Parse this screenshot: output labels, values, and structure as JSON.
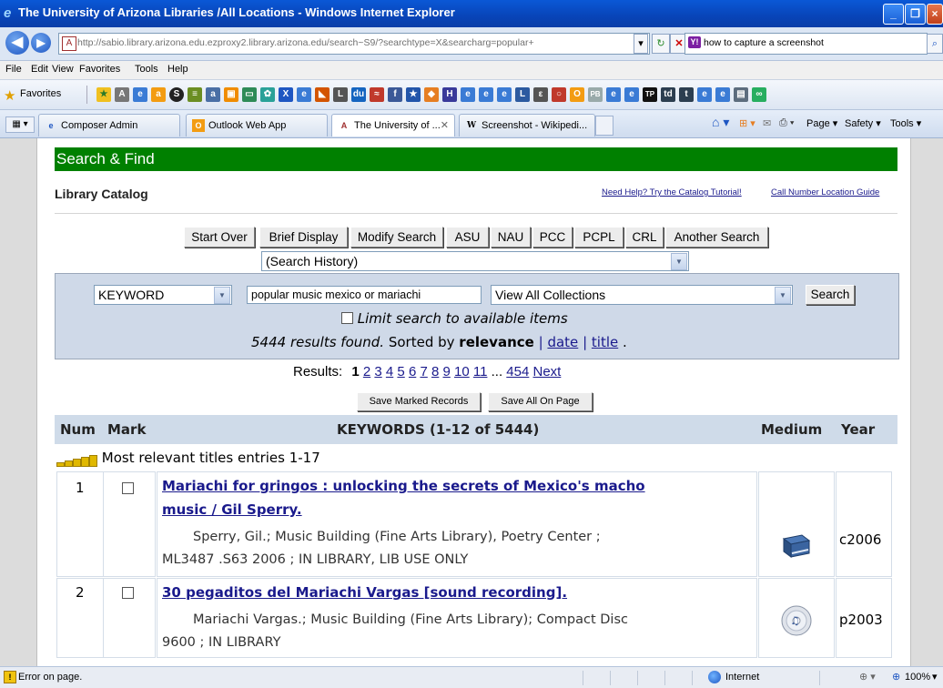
{
  "window": {
    "title": "The University of Arizona Libraries /All Locations - Windows Internet Explorer"
  },
  "address_bar": {
    "url": "http://sabio.library.arizona.edu.ezproxy2.library.arizona.edu/search~S9/?searchtype=X&searcharg=popular+",
    "search_text": "how to capture a screenshot"
  },
  "menu": [
    "File",
    "Edit",
    "View",
    "Favorites",
    "Tools",
    "Help"
  ],
  "favorites_label": "Favorites",
  "tabs": [
    {
      "label": "Composer Admin",
      "icon": "composer-icon"
    },
    {
      "label": "Outlook Web App",
      "icon": "outlook-icon"
    },
    {
      "label": "The University of ...",
      "icon": "ua-library-icon",
      "active": true
    },
    {
      "label": "Screenshot - Wikipedi...",
      "icon": "wikipedia-icon"
    }
  ],
  "commands": {
    "page": "Page",
    "safety": "Safety",
    "tools": "Tools"
  },
  "page": {
    "banner": "Search & Find",
    "section_title": "Library Catalog",
    "help_link": "Need Help? Try the Catalog Tutorial!",
    "guide_link": "Call Number Location Guide",
    "buttons": [
      "Start Over",
      "Brief Display",
      "Modify Search",
      "ASU",
      "NAU",
      "PCC",
      "PCPL",
      "CRL",
      "Another Search"
    ],
    "history_select": "(Search History)",
    "search": {
      "type": "KEYWORD",
      "query": "popular music mexico or mariachi",
      "collection": "View All Collections",
      "button": "Search",
      "limit_label": "Limit search to available items",
      "results_count": "5444 results found.",
      "sorted_by": "Sorted by",
      "sort_current": "relevance",
      "sort_date": "date",
      "sort_title": "title"
    },
    "pagination": {
      "label": "Results:",
      "current": "1",
      "pages": [
        "2",
        "3",
        "4",
        "5",
        "6",
        "7",
        "8",
        "9",
        "10",
        "11"
      ],
      "ellipsis": "...",
      "last": "454",
      "next": "Next"
    },
    "save_marked": "Save Marked Records",
    "save_all": "Save All On Page",
    "table": {
      "headers": {
        "num": "Num",
        "mark": "Mark",
        "keywords": "KEYWORDS (1-12 of 5444)",
        "medium": "Medium",
        "year": "Year"
      },
      "relevance_note": "Most relevant titles entries 1-17",
      "rows": [
        {
          "num": "1",
          "title_line1": "Mariachi for gringos : unlocking the secrets of Mexico's macho",
          "title_line2": "music / Gil Sperry.",
          "desc_line1": "Sperry, Gil.; Music Building (Fine Arts Library), Poetry Center ;",
          "desc_line2": "ML3487 .S63 2006 ; IN LIBRARY, LIB USE ONLY",
          "medium": "book-icon",
          "year": "c2006"
        },
        {
          "num": "2",
          "title_line1": "30 pegaditos del Mariachi Vargas [sound recording].",
          "desc_line1": "Mariachi Vargas.; Music Building (Fine Arts Library); Compact Disc",
          "desc_line2": "9600 ; IN LIBRARY",
          "medium": "cd-icon",
          "year": "p2003"
        }
      ]
    }
  },
  "status": {
    "left": "Error on page.",
    "zone": "Internet",
    "zoom": "100%"
  }
}
